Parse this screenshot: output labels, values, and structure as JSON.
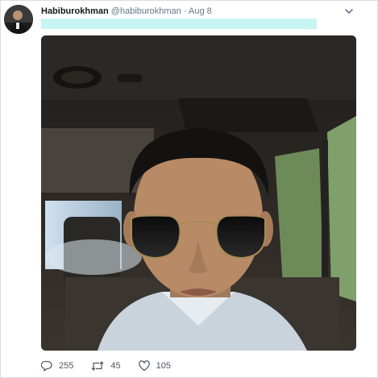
{
  "tweet": {
    "author_name": "Habiburokhman",
    "handle": "@habiburokhman",
    "separator": "·",
    "date": "Aug 8",
    "menu_icon": "chevron-down-icon",
    "avatar_icon": "profile-avatar",
    "photo_alt": "selfie photo"
  },
  "actions": {
    "reply_icon": "reply-icon",
    "reply_count": "255",
    "retweet_icon": "retweet-icon",
    "retweet_count": "45",
    "like_icon": "heart-icon",
    "like_count": "105"
  },
  "colors": {
    "highlight": "#c7f5f4",
    "name": "#14171a",
    "secondary": "#657786"
  }
}
